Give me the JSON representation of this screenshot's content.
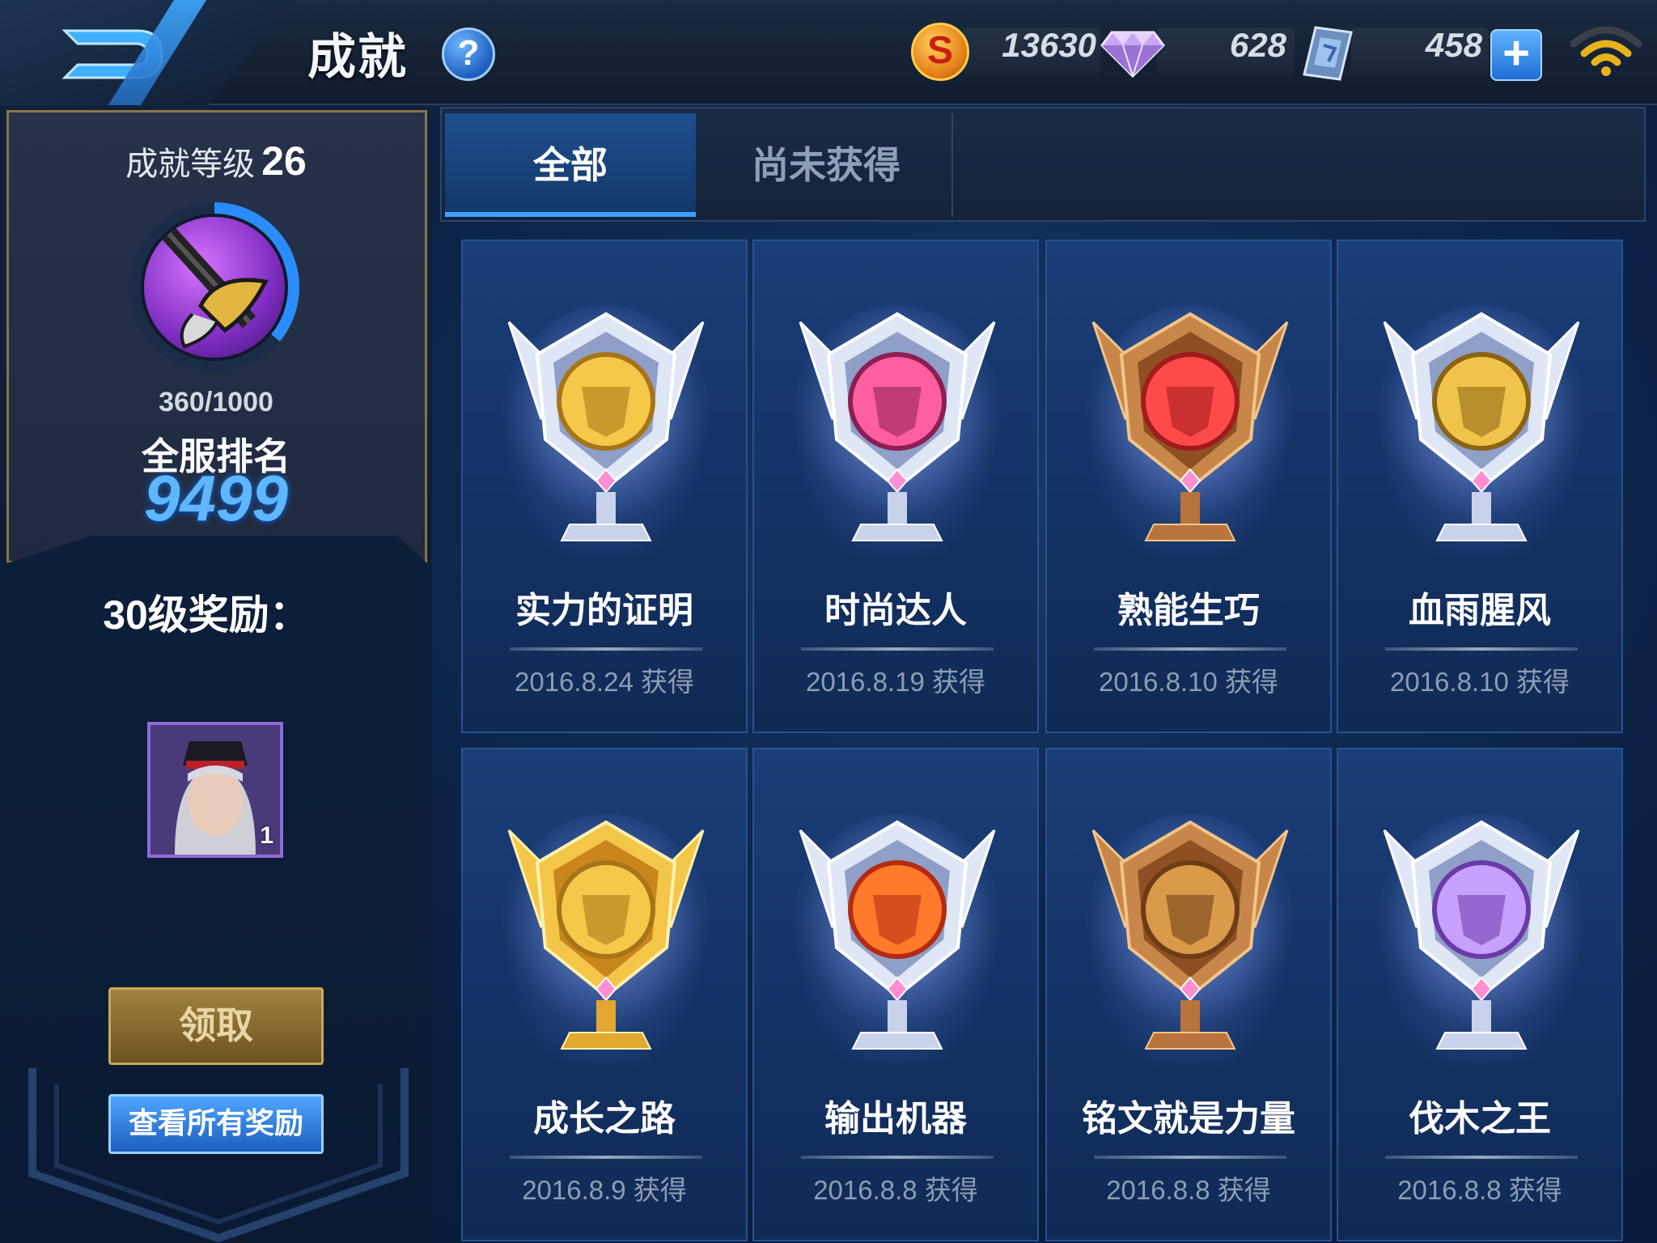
{
  "header": {
    "title": "成就",
    "help_symbol": "?",
    "currencies": {
      "gold": {
        "icon": "gold-coin-icon",
        "symbol": "S",
        "value": "13630"
      },
      "diamond": {
        "icon": "diamond-gem-icon",
        "value": "628"
      },
      "coupon": {
        "icon": "crystal-coupon-icon",
        "value": "458"
      }
    },
    "add_symbol": "+"
  },
  "profile": {
    "level_label": "成就等级",
    "level": "26",
    "exp": "360/1000",
    "exp_fraction": 0.36,
    "rank_label": "全服排名",
    "rank": "9499"
  },
  "reward": {
    "title": "30级奖励：",
    "item_count": "1",
    "claim_label": "领取",
    "view_all_label": "查看所有奖励"
  },
  "tabs": [
    {
      "label": "全部",
      "active": true
    },
    {
      "label": "尚未获得",
      "active": false
    }
  ],
  "achievements": [
    {
      "name": "实力的证明",
      "date": "2016.8.24 获得",
      "tier": "silver",
      "emblem": "golden-helmet"
    },
    {
      "name": "时尚达人",
      "date": "2016.8.19 获得",
      "tier": "silver",
      "emblem": "pink-mask"
    },
    {
      "name": "熟能生巧",
      "date": "2016.8.10 获得",
      "tier": "bronze",
      "emblem": "red-gem"
    },
    {
      "name": "血雨腥风",
      "date": "2016.8.10 获得",
      "tier": "silver",
      "emblem": "golden-skull"
    },
    {
      "name": "成长之路",
      "date": "2016.8.9 获得",
      "tier": "gold",
      "emblem": "golden-helmet"
    },
    {
      "name": "输出机器",
      "date": "2016.8.8 获得",
      "tier": "silver",
      "emblem": "flame-skull"
    },
    {
      "name": "铭文就是力量",
      "date": "2016.8.8 获得",
      "tier": "bronze",
      "emblem": "rune-v"
    },
    {
      "name": "伐木之王",
      "date": "2016.8.8 获得",
      "tier": "silver",
      "emblem": "axe-stump"
    }
  ],
  "colors": {
    "accent_blue": "#3ea0ff",
    "rank_blue": "#5fb8ff",
    "gold_border": "#8a7448",
    "card_bg": "#143264"
  }
}
